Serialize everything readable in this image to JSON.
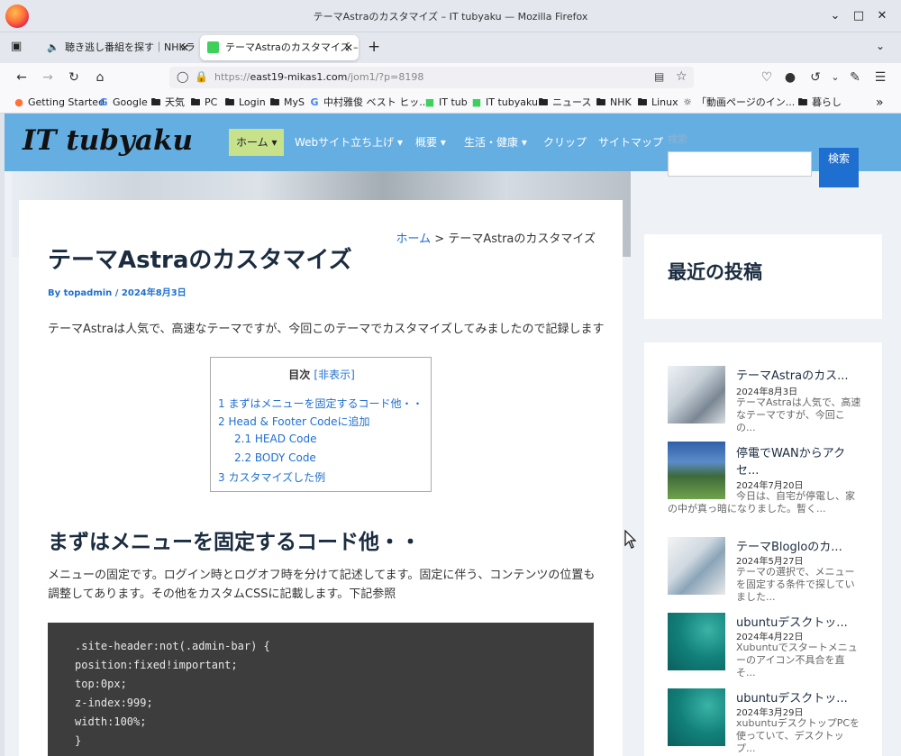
{
  "window": {
    "title": "テーマAstraのカスタマイズ – IT tubyaku — Mozilla Firefox"
  },
  "tabs": [
    {
      "label": "聴き逃し番組を探す｜NHKラジ",
      "active": false
    },
    {
      "label": "テーマAstraのカスタマイズ –",
      "active": true
    }
  ],
  "address": {
    "prefix": "https://",
    "host": "east19-mikas1.com",
    "path": "/jom1/?p=8198"
  },
  "bookmarks": [
    {
      "label": "Getting Started",
      "icon": "firefox-icon"
    },
    {
      "label": "Google",
      "icon": "google-icon"
    },
    {
      "label": "天気",
      "icon": "folder-icon"
    },
    {
      "label": "PC",
      "icon": "folder-icon"
    },
    {
      "label": "Login",
      "icon": "folder-icon"
    },
    {
      "label": "MyS",
      "icon": "folder-icon"
    },
    {
      "label": "中村雅俊 ベスト ヒッ...",
      "icon": "google-icon"
    },
    {
      "label": "IT tub",
      "icon": "site-icon"
    },
    {
      "label": "IT tubyaku",
      "icon": "site-icon"
    },
    {
      "label": "ニュース",
      "icon": "folder-icon"
    },
    {
      "label": "NHK",
      "icon": "folder-icon"
    },
    {
      "label": "Linux",
      "icon": "folder-icon"
    },
    {
      "label": "「動画ページのイン...",
      "icon": "page-icon"
    },
    {
      "label": "暮らし",
      "icon": "folder-icon"
    }
  ],
  "site": {
    "logo": "IT tubyaku",
    "menu": [
      {
        "label": "ホーム ▾"
      },
      {
        "label": "Webサイト立ち上げ ▾"
      },
      {
        "label": "概要 ▾"
      },
      {
        "label": "生活・健康 ▾"
      },
      {
        "label": "クリップ"
      },
      {
        "label": "サイトマップ"
      }
    ],
    "search_label": "検索",
    "search_button": "検索"
  },
  "article": {
    "breadcrumb_home": "ホーム",
    "breadcrumb_sep": " > ",
    "breadcrumb_current": "テーマAstraのカスタマイズ",
    "title": "テーマAstraのカスタマイズ",
    "meta": "By topadmin / 2024年8月3日",
    "intro": "テーマAstraは人気で、高速なテーマですが、今回このテーマでカスタマイズしてみましたので記録します",
    "toc": {
      "title": "目次",
      "toggle": "[非表示]",
      "items": [
        "1 まずはメニューを固定するコード他・・",
        "2 Head & Footer Codeに追加",
        "2.1 HEAD Code",
        "2.2 BODY Code",
        "3 カスタマイズした例"
      ]
    },
    "h2": "まずはメニューを固定するコード他・・",
    "para": "メニューの固定です。ログイン時とログオフ時を分けて記述してます。固定に伴う、コンテンツの位置も調整してあります。その他をカスタムCSSに記載します。下記参照",
    "code": [
      ".site-header:not(.admin-bar) {",
      "position:fixed!important;",
      "top:0px;",
      "z-index:999;",
      "width:100%;",
      "}"
    ]
  },
  "sidebar": {
    "recent_title": "最近の投稿",
    "posts": [
      {
        "title": "テーマAstraのカス...",
        "date": "2024年8月3日",
        "excerpt": "テーマAstraは人気で、高速なテーマですが、今回この..."
      },
      {
        "title": "停電でWANからアクセ...",
        "date": "2024年7月20日",
        "excerpt": "今日は、自宅が停電し、家の中が真っ暗になりました。暫く..."
      },
      {
        "title": "テーマBlogloのカ...",
        "date": "2024年5月27日",
        "excerpt": "テーマの選択で、メニューを固定する条件で探していました..."
      },
      {
        "title": "ubuntuデスクトッ...",
        "date": "2024年4月22日",
        "excerpt": "Xubuntuでスタートメニューのアイコン不具合を直そ..."
      },
      {
        "title": "ubuntuデスクトッ...",
        "date": "2024年3月29日",
        "excerpt": "xubuntuデスクトップPCを使っていて、デスクトップ..."
      }
    ]
  }
}
